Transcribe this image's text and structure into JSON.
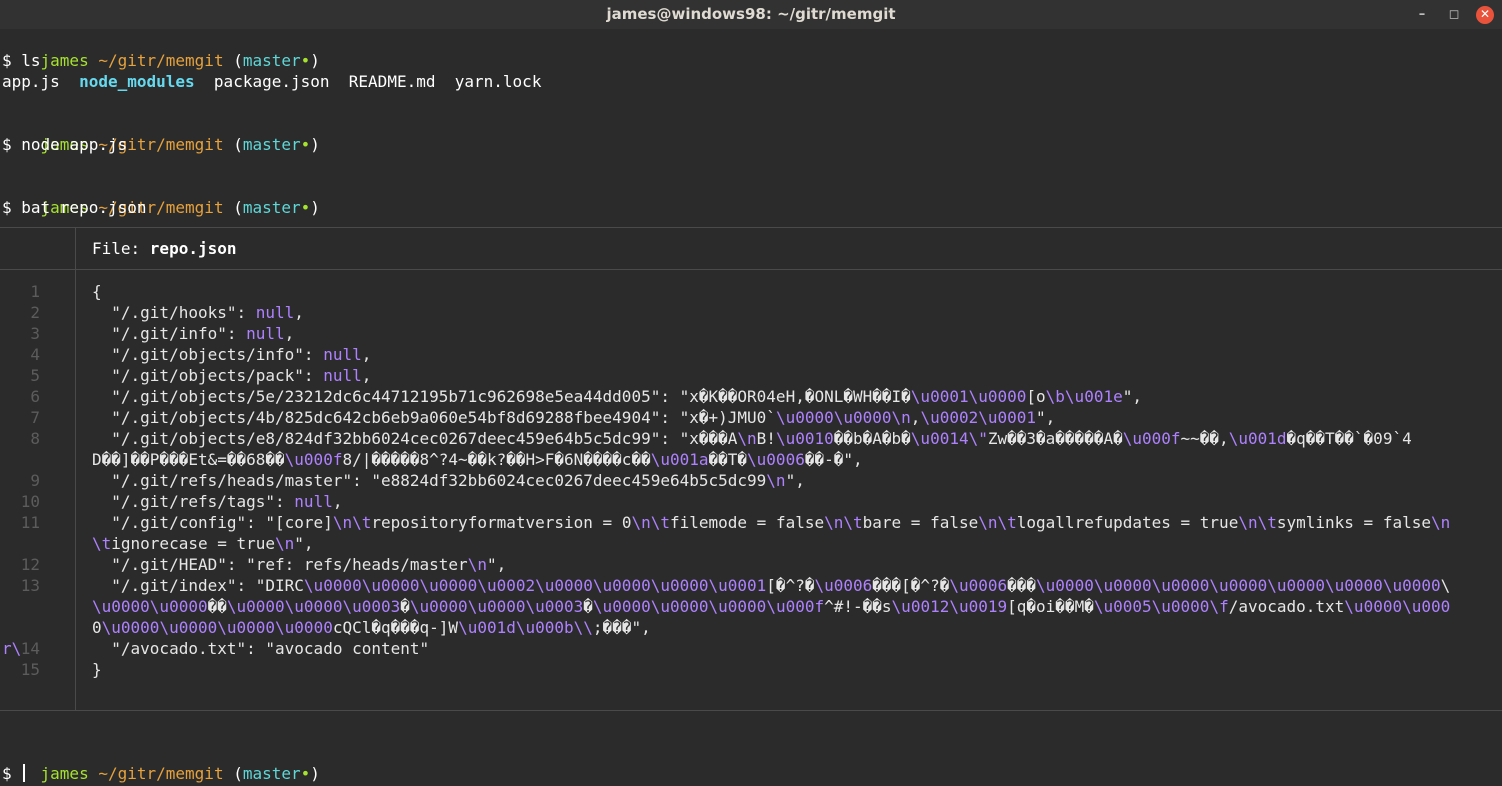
{
  "window": {
    "title": "james@windows98: ~/gitr/memgit",
    "minimize_icon": "minimize-icon",
    "maximize_icon": "maximize-icon",
    "close_icon": "close-icon"
  },
  "prompt": {
    "user": "james",
    "path": "~/gitr/memgit",
    "open_paren": " (",
    "branch": "master",
    "dot": "•",
    "close_paren": ")",
    "dollar": "$ "
  },
  "commands": {
    "ls": "ls",
    "node": "node app.js",
    "bat": "bat repo.json"
  },
  "ls_output": {
    "files": [
      "app.js",
      "node_modules",
      "package.json",
      "README.md",
      "yarn.lock"
    ]
  },
  "bat": {
    "file_label": "File: ",
    "file_name": "repo.json",
    "lines": [
      {
        "num": "1",
        "text": "{"
      },
      {
        "num": "2",
        "key": "  \"/.git/hooks\": ",
        "val": "null",
        "tail": ","
      },
      {
        "num": "3",
        "key": "  \"/.git/info\": ",
        "val": "null",
        "tail": ","
      },
      {
        "num": "4",
        "key": "  \"/.git/objects/info\": ",
        "val": "null",
        "tail": ","
      },
      {
        "num": "5",
        "key": "  \"/.git/objects/pack\": ",
        "val": "null",
        "tail": ","
      },
      {
        "num": "6",
        "text": "  \"/.git/objects/5e/23212dc6c44712195b71c962698e5ea44dd005\": \"x�K��OR04eH,�ONL�WH��I�\\u0001\\u0000[o\\b\\u001e\","
      },
      {
        "num": "7",
        "text": "  \"/.git/objects/4b/825dc642cb6eb9a060e54bf8d69288fbee4904\": \"x�+)JMU0`\\u0000\\u0000\\n,\\u0002\\u0001\","
      },
      {
        "num": "8",
        "text": "  \"/.git/objects/e8/824df32bb6024cec0267deec459e64b5c5dc99\": \"x���A\\nB!\\u0010��b�A�b�\\u0014\\\"Zw��3�a�����A�\\u000f~~��,\\u001d�q��T��`�09`4"
      },
      {
        "num": "",
        "text": "D��]��P���Et&=��68��\\u000f8/|�����8^?4~��k?��H>F�6N����c��\\u001a��T�\\u0006��-�\","
      },
      {
        "num": "9",
        "text": "  \"/.git/refs/heads/master\": \"e8824df32bb6024cec0267deec459e64b5c5dc99\\n\","
      },
      {
        "num": "10",
        "key": "  \"/.git/refs/tags\": ",
        "val": "null",
        "tail": ","
      },
      {
        "num": "11",
        "text": "  \"/.git/config\": \"[core]\\n\\trepositoryformatversion = 0\\n\\tfilemode = false\\n\\tbare = false\\n\\tlogallrefupdates = true\\n\\tsymlinks = false\\n"
      },
      {
        "num": "",
        "text": "\\tignorecase = true\\n\","
      },
      {
        "num": "12",
        "text": "  \"/.git/HEAD\": \"ref: refs/heads/master\\n\","
      },
      {
        "num": "13",
        "text": "  \"/.git/index\": \"DIRC\\u0000\\u0000\\u0000\\u0002\\u0000\\u0000\\u0000\\u0001[�^?�\\u0006���[�^?�\\u0006���\\u0000\\u0000\\u0000\\u0000\\u0000\\u0000\\u0000\\"
      },
      {
        "num": "",
        "text": "\\u0000\\u0000��\\u0000\\u0000\\u0003�\\u0000\\u0000\\u0003�\\u0000\\u0000\\u0000\\u000f^#!-��s\\u0012\\u0019[q�oi��M�\\u0005\\u0000\\f/avocado.txt\\u0000\\u000"
      },
      {
        "num": "",
        "text": "0\\u0000\\u0000\\u0000\\u0000cQCl�q���q-]W\\u001d\\u000b\\\\;���\","
      },
      {
        "num": "14",
        "text": "  \"/avocado.txt\": \"avocado content\""
      },
      {
        "num": "15",
        "text": "}"
      }
    ],
    "wrap_r": "r\\"
  }
}
